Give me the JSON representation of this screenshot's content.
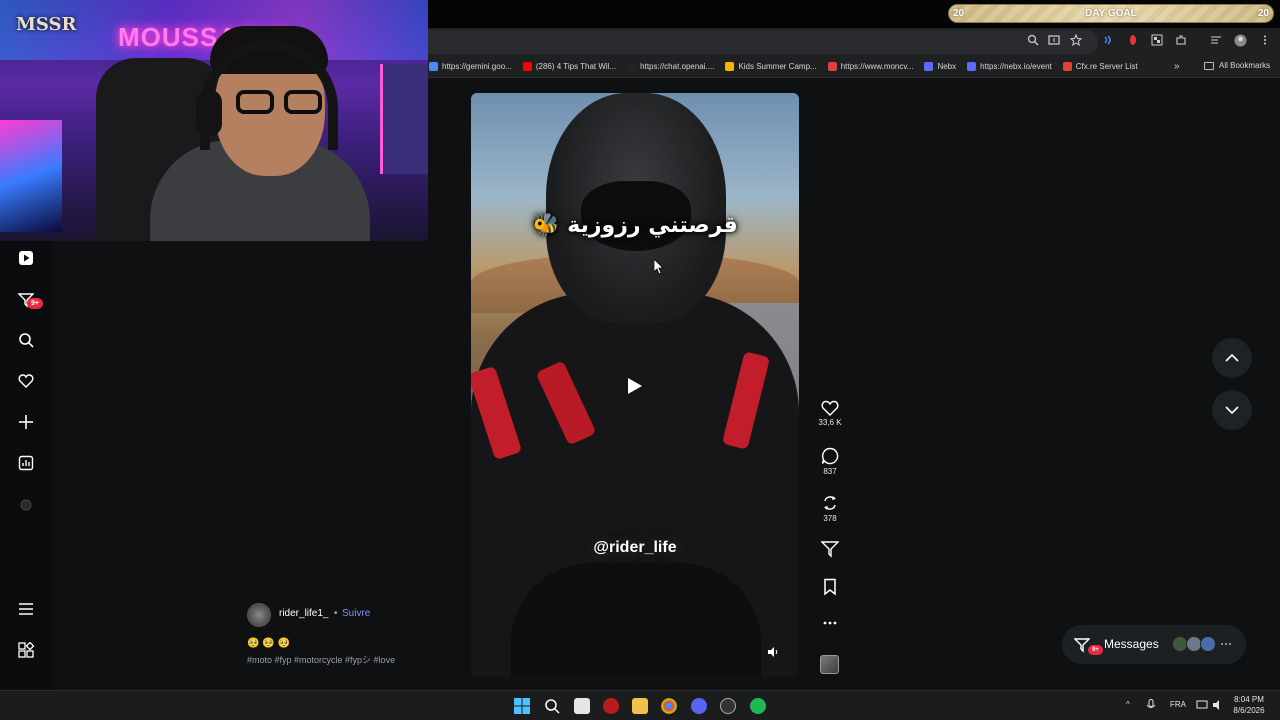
{
  "day_goal": {
    "left_count": "20",
    "title": "DAY GOAL",
    "right_count": "20"
  },
  "webcam": {
    "sign_text": "MOUSSAOUI",
    "logo_text": "MSSR"
  },
  "bookmarks": [
    {
      "label": "https://gemini.goo...",
      "color": "#4a88ff"
    },
    {
      "label": "(286) 4 Tips That Wil...",
      "color": "#ff0000"
    },
    {
      "label": "https://chat.openai....",
      "color": "#222222"
    },
    {
      "label": "Kids Summer Camp...",
      "color": "#f2b600"
    },
    {
      "label": "https://www.moncv...",
      "color": "#e04040"
    },
    {
      "label": "Nebx",
      "color": "#5a6cff"
    },
    {
      "label": "https://nebx.io/event",
      "color": "#5a6cff"
    },
    {
      "label": "Cfx.re Server List",
      "color": "#e0442e"
    }
  ],
  "bookmarks_all": "All Bookmarks",
  "video": {
    "caption": "قرصتني رزوزية 🐝",
    "tag": "@rider_life"
  },
  "actions": {
    "likes": "33,6 K",
    "comments": "837",
    "reposts": "378"
  },
  "post": {
    "username": "rider_life1_",
    "separator": "•",
    "follow": "Suivre",
    "emojis": "🥺 🥺 🥺",
    "hashtags": "#moto #fyp #motorcycle #fypシ #love"
  },
  "sidebar": {
    "notif_badge": "9+"
  },
  "messages": {
    "label": "Messages",
    "badge": "9+"
  },
  "taskbar": {
    "lang": "FRA",
    "time": "8:04 PM",
    "date": "8/6/2026"
  }
}
